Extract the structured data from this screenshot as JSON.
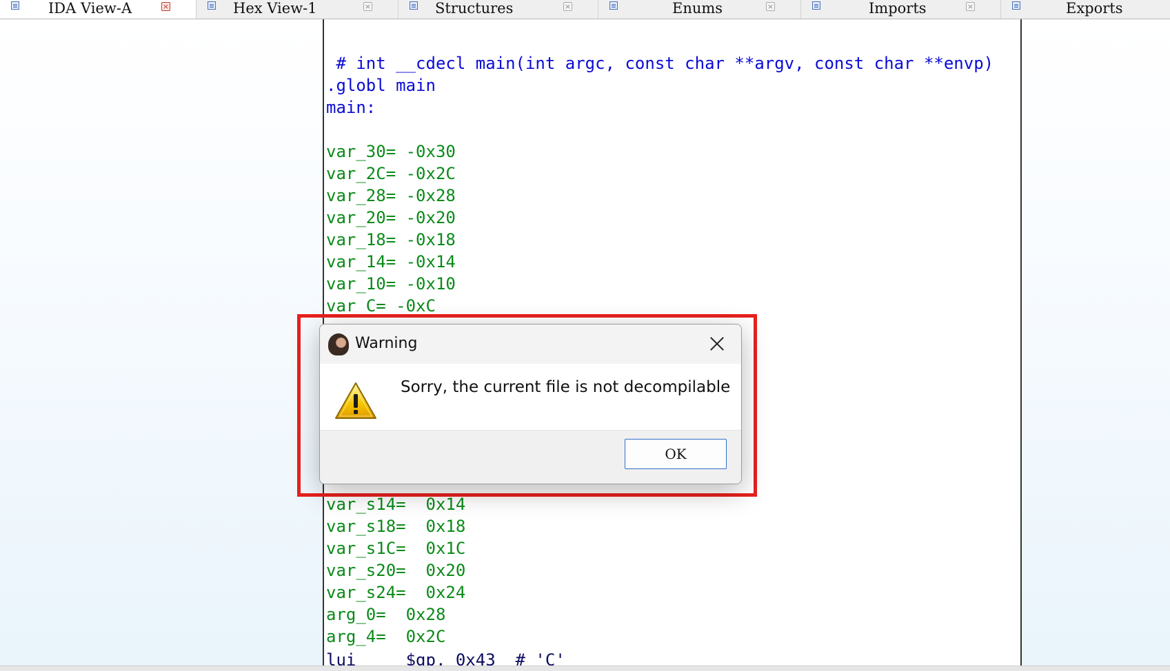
{
  "tabs": [
    {
      "label": "IDA View-A",
      "close": "×"
    },
    {
      "label": "Hex View-1",
      "close": "×"
    },
    {
      "label": "Structures",
      "close": "×"
    },
    {
      "label": "Enums",
      "close": "×"
    },
    {
      "label": "Imports",
      "close": "×"
    },
    {
      "label": "Exports",
      "close": "×"
    }
  ],
  "code": {
    "header": " # int __cdecl main(int argc, const char **argv, const char **envp)",
    "globl": ".globl main",
    "label": "main:",
    "vars_top": [
      "var_30= -0x30",
      "var_2C= -0x2C",
      "var_28= -0x28",
      "var_20= -0x20",
      "var_18= -0x18",
      "var_14= -0x14",
      "var_10= -0x10",
      "var_C= -0xC"
    ],
    "vars_partial": "var_s14=  0x14",
    "vars_bottom": [
      "var_s18=  0x18",
      "var_s1C=  0x1C",
      "var_s20=  0x20",
      "var_s24=  0x24",
      "arg_0=  0x28",
      "arg_4=  0x2C"
    ],
    "last_line": "lui     $gp, 0x43  # 'C'"
  },
  "dialog": {
    "title": "Warning",
    "message": "Sorry, the current file is not decompilable",
    "ok_label": "OK"
  },
  "colors": {
    "highlight": "#e8201d",
    "code_blue": "#0b0bd6",
    "code_green": "#0a8a18",
    "ok_border": "#2f6ec9"
  },
  "icons": {
    "dialog_app": "portrait-icon",
    "dialog_warning": "warning-triangle-icon",
    "dialog_close": "close-icon"
  }
}
